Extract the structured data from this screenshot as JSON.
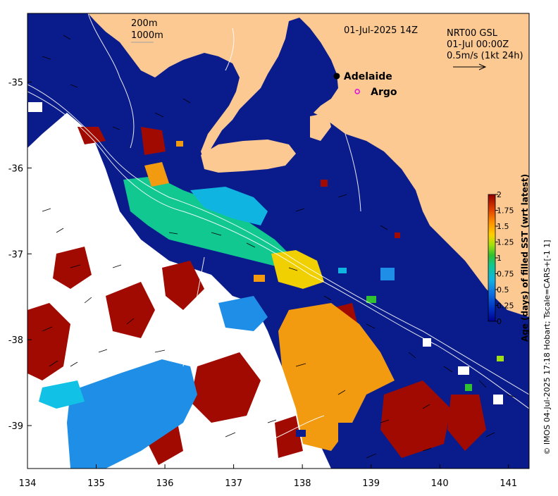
{
  "map": {
    "title_date": "01-Jul-2025 14Z",
    "product_lines": [
      "NRT00 GSL",
      "01-Jul 00:00Z",
      "0.5m/s (1kt 24h)"
    ],
    "depth_legend": [
      "200m",
      "1000m"
    ],
    "credit": "© IMOS 04-Jul-2025 17:18 Hobart; Tscale=CARS+[-1 1]",
    "markers": [
      {
        "label": "Adelaide",
        "lon": 138.5,
        "lat": -34.93,
        "style": "dot"
      },
      {
        "label": "Argo",
        "lon": 138.8,
        "lat": -35.11,
        "style": "ring"
      }
    ],
    "x_axis": {
      "range": [
        134,
        141.3
      ],
      "ticks": [
        "134",
        "135",
        "136",
        "137",
        "138",
        "139",
        "140",
        "141"
      ]
    },
    "y_axis": {
      "range": [
        -39.5,
        -34.2
      ],
      "ticks": [
        "-35",
        "-36",
        "-37",
        "-38",
        "-39"
      ]
    },
    "colors": {
      "land": "#fcc992",
      "ocean_recent": "#0a1c8c",
      "missing": "#ffffff",
      "old": "#a00a00",
      "marker_argo": "#e010e0"
    }
  },
  "colorbar": {
    "label": "Age (days) of filled SST (wrt latest)",
    "ticks": [
      "0",
      "0.25",
      "0.5",
      "0.75",
      "1",
      "1.25",
      "1.5",
      "1.75",
      "2"
    ],
    "range": [
      0,
      2
    ],
    "colors": [
      "#00008f",
      "#0030c0",
      "#1070e0",
      "#10b4e0",
      "#10c890",
      "#30c030",
      "#a0e010",
      "#ffd000",
      "#ff9000",
      "#e04000",
      "#900000"
    ]
  }
}
